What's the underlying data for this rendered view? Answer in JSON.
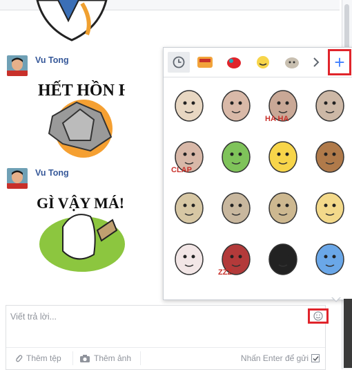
{
  "messages": [
    {
      "sender": "Vu Tong",
      "sticker_text": "HẾT HỒN HÀ"
    },
    {
      "sender": "Vu Tong",
      "sticker_text": "GÌ VẬY MÁ!"
    }
  ],
  "composer": {
    "placeholder": "Viết trả lời...",
    "attach_file_label": "Thêm tệp",
    "add_photo_label": "Thêm ảnh",
    "enter_to_send_label": "Nhấn Enter để gửi",
    "enter_to_send_checked": true
  },
  "sticker_picker": {
    "tabs": [
      "recent-icon",
      "pack-1",
      "pack-2",
      "pack-3",
      "pack-4",
      "next-arrow"
    ],
    "add_label": "+",
    "stickers": [
      {
        "name": "sticker-dog-cry"
      },
      {
        "name": "sticker-bunny-grumpy"
      },
      {
        "name": "sticker-bunny-haha",
        "text": "HA HA"
      },
      {
        "name": "sticker-bunny-sad"
      },
      {
        "name": "sticker-bunny-clap",
        "text": "CLAP"
      },
      {
        "name": "sticker-frog-rain"
      },
      {
        "name": "sticker-face-shocked"
      },
      {
        "name": "sticker-monkey-wink"
      },
      {
        "name": "sticker-bunny-nervous"
      },
      {
        "name": "sticker-bunny-crying"
      },
      {
        "name": "sticker-bunny-thinking"
      },
      {
        "name": "sticker-face-sad"
      },
      {
        "name": "sticker-rabbit-love"
      },
      {
        "name": "sticker-sleep-zzz",
        "text": "ZZZ"
      },
      {
        "name": "sticker-girl-shocked"
      },
      {
        "name": "sticker-joy-character"
      }
    ]
  },
  "colors": {
    "accent": "#4080ff",
    "link": "#365899",
    "highlight": "#e0242b"
  }
}
